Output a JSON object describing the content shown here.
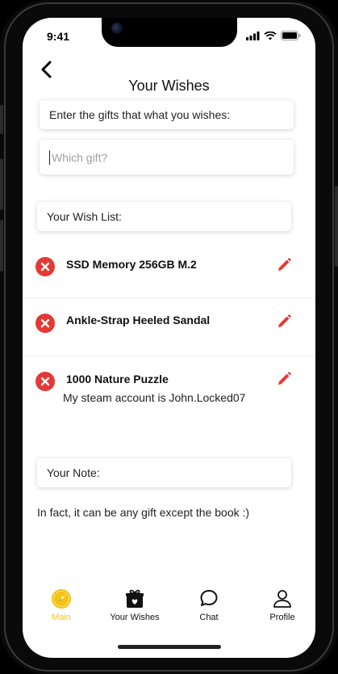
{
  "status_bar": {
    "time": "9:41"
  },
  "header": {
    "title": "Your Wishes"
  },
  "form": {
    "prompt": "Enter the gifts that what you wishes:",
    "gift_placeholder": "Which gift?",
    "gift_value": ""
  },
  "wishlist": {
    "title": "Your Wish List:",
    "items": [
      {
        "name": "SSD Memory 256GB M.2",
        "note": ""
      },
      {
        "name": "Ankle-Strap Heeled Sandal",
        "note": ""
      },
      {
        "name": "1000 Nature Puzzle",
        "note": "My steam account is John.Locked07"
      }
    ]
  },
  "note": {
    "title": "Your Note:",
    "text": "In fact, it can be any gift except the book :)"
  },
  "tabbar": {
    "active_color": "#f2c318",
    "tabs": [
      {
        "label": "Main",
        "icon": "compass-icon",
        "active": true
      },
      {
        "label": "Your Wishes",
        "icon": "gift-box-icon",
        "active": false
      },
      {
        "label": "Chat",
        "icon": "chat-bubble-icon",
        "active": false
      },
      {
        "label": "Profile",
        "icon": "user-icon",
        "active": false
      }
    ]
  },
  "colors": {
    "remove": "#e53935",
    "edit": "#e53935",
    "accent": "#f2c318"
  }
}
